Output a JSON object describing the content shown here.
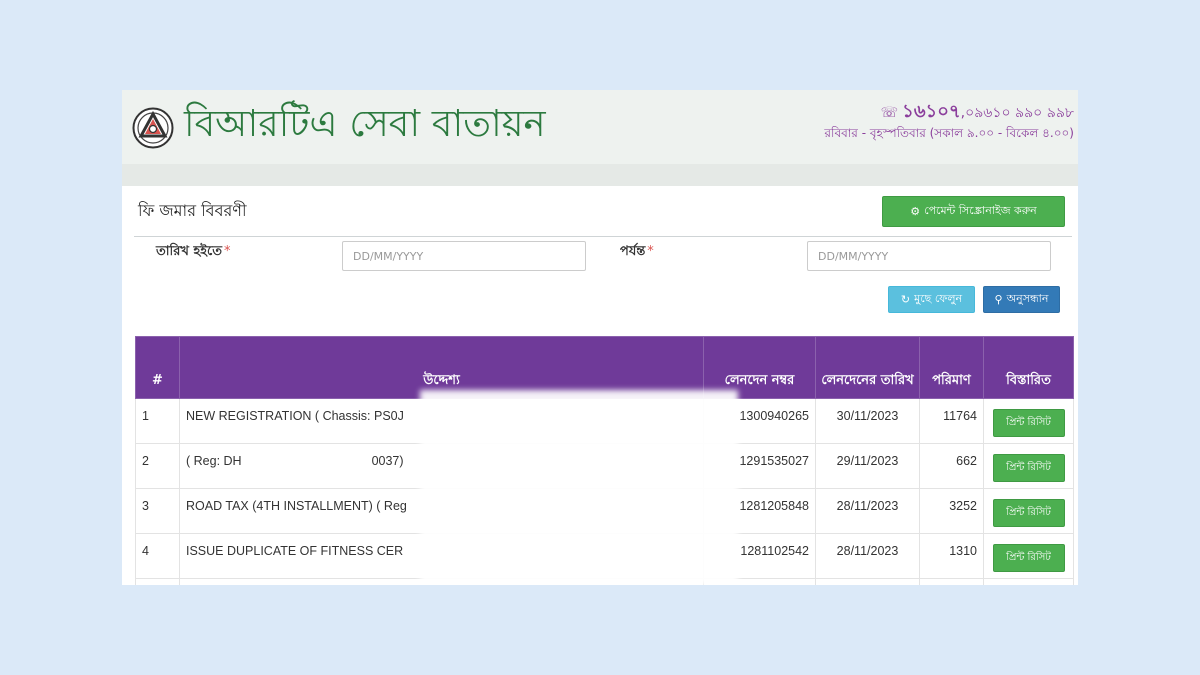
{
  "header": {
    "site_title": "বিআরটিএ সেবা বাতায়ন",
    "hotline": "১৬১০৭",
    "phone_extra": ",০৯৬১০ ৯৯০ ৯৯৮",
    "hours": "রবিবার - বৃহস্পতিবার (সকাল ৯.০০ - বিকেল ৪.০০)"
  },
  "page": {
    "section_title": "ফি জমার বিবরণী",
    "sync_button": "পেমেন্ট সিঙ্ক্রোনাইজ করুন"
  },
  "filters": {
    "from_label": "তারিখ হইতে",
    "to_label": "পর্যন্ত",
    "required_mark": "*",
    "from_placeholder": "DD/MM/YYYY",
    "to_placeholder": "DD/MM/YYYY",
    "clear_button": "মুছে ফেলুন",
    "search_button": "অনুসন্ধান"
  },
  "table": {
    "headers": {
      "index": "#",
      "purpose": "উদ্দেশ্য",
      "txn_no": "লেনদেন নম্বর",
      "txn_date": "লেনদেনের তারিখ",
      "amount": "পরিমাণ",
      "details": "বিস্তারিত"
    },
    "print_label": "প্রিন্ট রিসিট",
    "rows": [
      {
        "index": "1",
        "purpose": "NEW REGISTRATION ( Chassis: PS0J",
        "txn_no": "1300940265",
        "date": "30/11/2023",
        "amount": "11764"
      },
      {
        "index": "2",
        "purpose": "( Reg: DH",
        "purpose_tail": "0037)",
        "txn_no": "1291535027",
        "date": "29/11/2023",
        "amount": "662"
      },
      {
        "index": "3",
        "purpose": "ROAD TAX (4TH INSTALLMENT) ( Reg",
        "txn_no": "1281205848",
        "date": "28/11/2023",
        "amount": "3252"
      },
      {
        "index": "4",
        "purpose": "ISSUE DUPLICATE OF FITNESS CER",
        "txn_no": "1281102542",
        "date": "28/11/2023",
        "amount": "1310"
      }
    ]
  },
  "colors": {
    "brand_green": "#2c7a3f",
    "header_purple": "#6f3a99",
    "contact_purple": "#8b3f9c",
    "button_green": "#4caf50",
    "button_info": "#5bc0de",
    "button_primary": "#337ab7"
  },
  "icons": {
    "logo": "brta-logo-icon",
    "phone": "phone-icon",
    "sync": "cogs-icon",
    "clear": "refresh-icon",
    "search": "search-icon"
  }
}
